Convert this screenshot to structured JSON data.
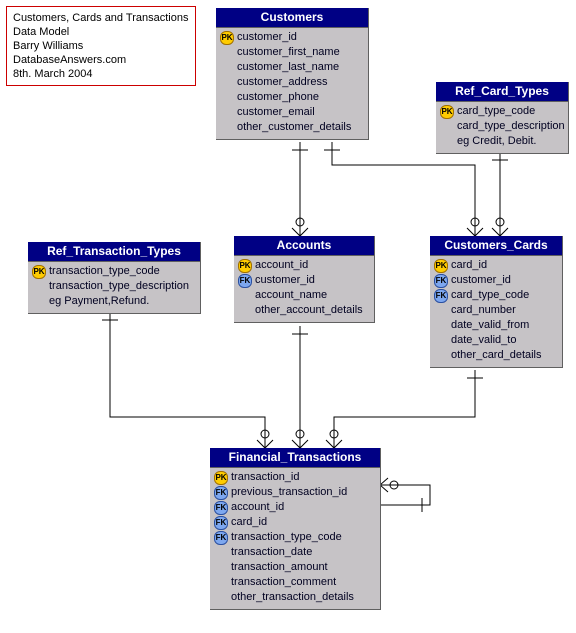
{
  "title_box": {
    "line1": "Customers, Cards and Transactions",
    "line2": "Data Model",
    "line3": "Barry Williams",
    "line4": "DatabaseAnswers.com",
    "line5": "8th. March 2004"
  },
  "key_labels": {
    "pk": "PK",
    "fk": "FK"
  },
  "entities": {
    "customers": {
      "name": "Customers",
      "cols": [
        {
          "k": "pk",
          "n": "customer_id"
        },
        {
          "k": "",
          "n": "customer_first_name"
        },
        {
          "k": "",
          "n": "customer_last_name"
        },
        {
          "k": "",
          "n": "customer_address"
        },
        {
          "k": "",
          "n": "customer_phone"
        },
        {
          "k": "",
          "n": "customer_email"
        },
        {
          "k": "",
          "n": "other_customer_details"
        }
      ]
    },
    "ref_card_types": {
      "name": "Ref_Card_Types",
      "cols": [
        {
          "k": "pk",
          "n": "card_type_code"
        },
        {
          "k": "",
          "n": "card_type_description"
        },
        {
          "k": "",
          "n": "eg Credit, Debit."
        }
      ]
    },
    "ref_transaction_types": {
      "name": "Ref_Transaction_Types",
      "cols": [
        {
          "k": "pk",
          "n": "transaction_type_code"
        },
        {
          "k": "",
          "n": "transaction_type_description"
        },
        {
          "k": "",
          "n": "eg Payment,Refund."
        }
      ]
    },
    "accounts": {
      "name": "Accounts",
      "cols": [
        {
          "k": "pk",
          "n": "account_id"
        },
        {
          "k": "fk",
          "n": "customer_id"
        },
        {
          "k": "",
          "n": "account_name"
        },
        {
          "k": "",
          "n": "other_account_details"
        }
      ]
    },
    "customers_cards": {
      "name": "Customers_Cards",
      "cols": [
        {
          "k": "pk",
          "n": "card_id"
        },
        {
          "k": "fk",
          "n": "customer_id"
        },
        {
          "k": "fk",
          "n": "card_type_code"
        },
        {
          "k": "",
          "n": "card_number"
        },
        {
          "k": "",
          "n": "date_valid_from"
        },
        {
          "k": "",
          "n": "date_valid_to"
        },
        {
          "k": "",
          "n": "other_card_details"
        }
      ]
    },
    "financial_transactions": {
      "name": "Financial_Transactions",
      "cols": [
        {
          "k": "pk",
          "n": "transaction_id"
        },
        {
          "k": "fk",
          "n": "previous_transaction_id"
        },
        {
          "k": "fk",
          "n": "account_id"
        },
        {
          "k": "fk",
          "n": "card_id"
        },
        {
          "k": "fk",
          "n": "transaction_type_code"
        },
        {
          "k": "",
          "n": "transaction_date"
        },
        {
          "k": "",
          "n": "transaction_amount"
        },
        {
          "k": "",
          "n": "transaction_comment"
        },
        {
          "k": "",
          "n": "other_transaction_details"
        }
      ]
    }
  }
}
